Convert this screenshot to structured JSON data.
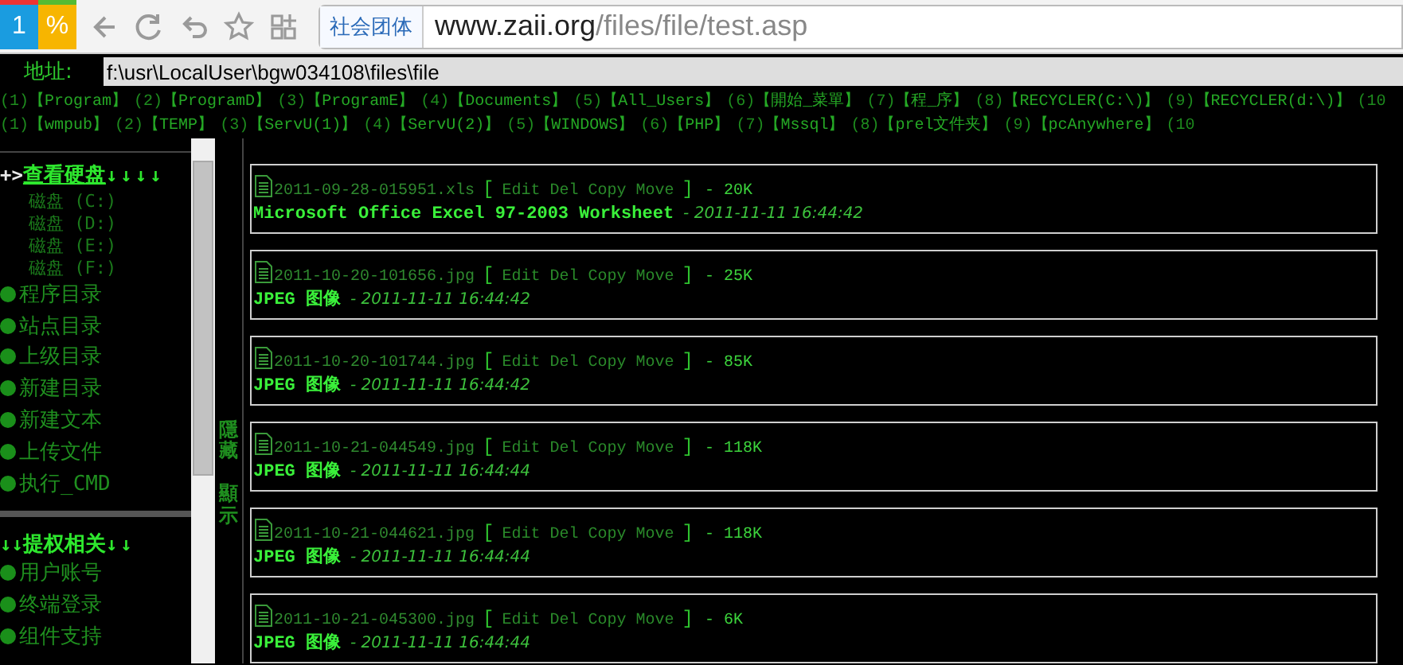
{
  "browser": {
    "logo": [
      "1",
      "%"
    ],
    "site_tag": "社会团体",
    "url_host": "www.zaii.org",
    "url_path": "/files/file/test.asp"
  },
  "address": {
    "label": "地址:",
    "value": "f:\\usr\\LocalUser\\bgw034108\\files\\file"
  },
  "shortcut_rows": [
    [
      {
        "num": "(1)",
        "label": "【Program】"
      },
      {
        "num": "(2)",
        "label": "【ProgramD】"
      },
      {
        "num": "(3)",
        "label": "【ProgramE】"
      },
      {
        "num": "(4)",
        "label": "【Documents】"
      },
      {
        "num": "(5)",
        "label": "【All_Users】"
      },
      {
        "num": "(6)",
        "label": "【開始_菜單】"
      },
      {
        "num": "(7)",
        "label": "【程_序】"
      },
      {
        "num": "(8)",
        "label": "【RECYCLER(C:\\)】"
      },
      {
        "num": "(9)",
        "label": "【RECYCLER(d:\\)】"
      },
      {
        "num": "(10"
      }
    ],
    [
      {
        "num": "(1)",
        "label": "【wmpub】"
      },
      {
        "num": "(2)",
        "label": "【TEMP】"
      },
      {
        "num": "(3)",
        "label": "【ServU(1)】"
      },
      {
        "num": "(4)",
        "label": "【ServU(2)】"
      },
      {
        "num": "(5)",
        "label": "【WINDOWS】"
      },
      {
        "num": "(6)",
        "label": "【PHP】"
      },
      {
        "num": "(7)",
        "label": "【Mssql】"
      },
      {
        "num": "(8)",
        "label": "【prel文件夹】"
      },
      {
        "num": "(9)",
        "label": "【pcAnywhere】"
      },
      {
        "num": "(10"
      }
    ]
  ],
  "sidebar": [
    {
      "prefix": "+>",
      "title": "查看硬盘",
      "suffix": "↓↓↓↓",
      "active": true,
      "items": [
        {
          "kind": "sub",
          "label": "磁盘 (C:)"
        },
        {
          "kind": "sub",
          "label": "磁盘 (D:)"
        },
        {
          "kind": "sub",
          "label": "磁盘 (E:)"
        },
        {
          "kind": "sub",
          "label": "磁盘 (F:)"
        },
        {
          "kind": "bullet",
          "label": "程序目录"
        },
        {
          "kind": "bullet",
          "label": "站点目录"
        },
        {
          "kind": "bullet",
          "label": "上级目录"
        },
        {
          "kind": "bullet",
          "label": "新建目录"
        },
        {
          "kind": "bullet",
          "label": "新建文本"
        },
        {
          "kind": "bullet",
          "label": "上传文件"
        },
        {
          "kind": "bullet",
          "label": "执行_CMD"
        }
      ]
    },
    {
      "prefix": "↓↓",
      "title": "提权相关",
      "suffix": "↓↓",
      "active": false,
      "items": [
        {
          "kind": "bullet",
          "label": "用户账号"
        },
        {
          "kind": "bullet",
          "label": "终端登录"
        },
        {
          "kind": "bullet",
          "label": "组件支持"
        }
      ]
    }
  ],
  "toggle": {
    "hide_label": "隱藏",
    "show_label": "顯示"
  },
  "files": [
    {
      "name": "2011-09-28-015951.xls",
      "open": "[",
      "actions": [
        "Edit",
        "Del",
        "Copy",
        "Move"
      ],
      "close": "]",
      "size": "- 20K",
      "type": "Microsoft Office Excel 97-2003 Worksheet",
      "date": "- 2011-11-11 16:44:42"
    },
    {
      "name": "2011-10-20-101656.jpg",
      "open": "[",
      "actions": [
        "Edit",
        "Del",
        "Copy",
        "Move"
      ],
      "close": "]",
      "size": "- 25K",
      "type": "JPEG 图像",
      "date": "- 2011-11-11 16:44:42"
    },
    {
      "name": "2011-10-20-101744.jpg",
      "open": "[",
      "actions": [
        "Edit",
        "Del",
        "Copy",
        "Move"
      ],
      "close": "]",
      "size": "- 85K",
      "type": "JPEG 图像",
      "date": "- 2011-11-11 16:44:42"
    },
    {
      "name": "2011-10-21-044549.jpg",
      "open": "[",
      "actions": [
        "Edit",
        "Del",
        "Copy",
        "Move"
      ],
      "close": "]",
      "size": "- 118K",
      "type": "JPEG 图像",
      "date": "- 2011-11-11 16:44:44"
    },
    {
      "name": "2011-10-21-044621.jpg",
      "open": "[",
      "actions": [
        "Edit",
        "Del",
        "Copy",
        "Move"
      ],
      "close": "]",
      "size": "- 118K",
      "type": "JPEG 图像",
      "date": "- 2011-11-11 16:44:44"
    },
    {
      "name": "2011-10-21-045300.jpg",
      "open": "[",
      "actions": [
        "Edit",
        "Del",
        "Copy",
        "Move"
      ],
      "close": "]",
      "size": "- 6K",
      "type": "JPEG 图像",
      "date": "- 2011-11-11 16:44:44"
    }
  ]
}
